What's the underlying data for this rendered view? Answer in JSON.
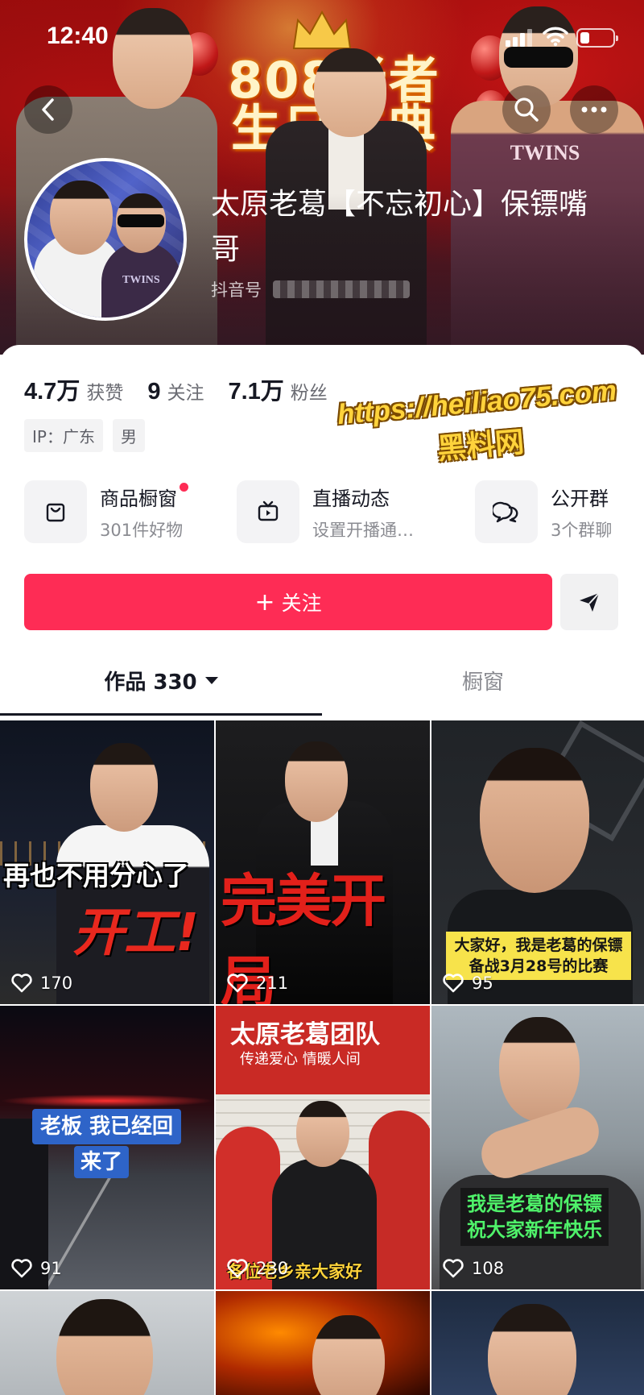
{
  "status_bar": {
    "time": "12:40"
  },
  "banner": {
    "event_sign_line1": "808老者",
    "event_sign_line2": "生日庆典"
  },
  "profile": {
    "name": "太原老葛【不忘初心】保镖嘴哥",
    "douyin_id_label": "抖音号"
  },
  "stats": [
    {
      "value": "4.7万",
      "label": "获赞"
    },
    {
      "value": "9",
      "label": "关注"
    },
    {
      "value": "7.1万",
      "label": "粉丝"
    }
  ],
  "tags": [
    "IP：广东",
    "男"
  ],
  "watermark": {
    "url": "https://heiliao75.com",
    "name": "黑料网"
  },
  "shortcuts": [
    {
      "title": "商品橱窗",
      "subtitle": "301件好物",
      "icon": "shopping-bag-icon"
    },
    {
      "title": "直播动态",
      "subtitle": "设置开播通…",
      "icon": "tv-icon"
    },
    {
      "title": "公开群",
      "subtitle": "3个群聊",
      "icon": "group-chat-icon"
    }
  ],
  "actions": {
    "follow_label": "关注",
    "share_icon": "send-icon"
  },
  "tabs": {
    "works_label": "作品 330",
    "showcase_label": "橱窗"
  },
  "videos": [
    {
      "likes": "170",
      "caption1": "再也不用分心了",
      "caption2": "开工!"
    },
    {
      "likes": "211",
      "caption1": "完美开局"
    },
    {
      "likes": "95",
      "caption1": "大家好，我是老葛的保镖",
      "caption2": "备战3月28号的比赛"
    },
    {
      "likes": "91",
      "caption1": "老板 我已经回",
      "caption2": "来了"
    },
    {
      "likes": "230",
      "caption1": "太原老葛团队",
      "caption2": "传递爱心 情暖人间",
      "caption3": "各位老乡亲大家好"
    },
    {
      "likes": "108",
      "caption1": "我是老葛的保镖",
      "caption2": "祝大家新年快乐"
    }
  ],
  "colors": {
    "accent": "#fe2c55",
    "text": "#161823",
    "muted": "#8a8b91"
  }
}
